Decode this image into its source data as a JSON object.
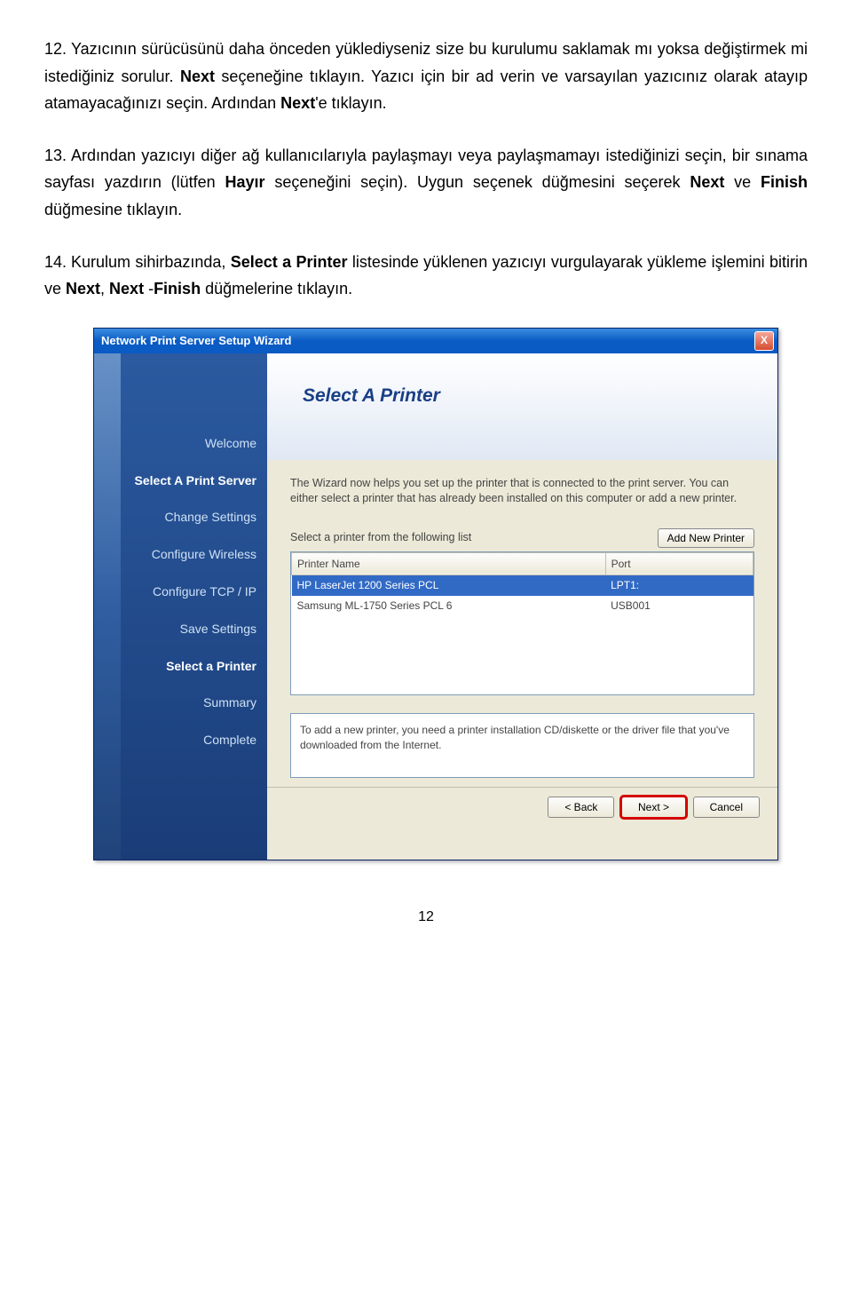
{
  "paragraphs": {
    "p12": {
      "num": "12.",
      "text_a": "Yazıcının sürücüsünü daha önceden yüklediyseniz size bu kurulumu saklamak mı yoksa değiştirmek mi istediğiniz sorulur. ",
      "bold_a": "Next",
      "text_b": " seçeneğine tıklayın. Yazıcı için bir ad verin ve varsayılan yazıcınız olarak atayıp atamayacağınızı seçin. Ardından ",
      "bold_b": "Next",
      "text_c": "'e tıklayın."
    },
    "p13": {
      "num": "13.",
      "text_a": "Ardından yazıcıyı diğer ağ kullanıcılarıyla paylaşmayı veya paylaşmamayı istediğinizi seçin, bir sınama sayfası yazdırın (lütfen ",
      "bold_a": "Hayır",
      "text_b": " seçeneğini seçin). Uygun seçenek düğmesini seçerek ",
      "bold_b": "Next",
      "text_c": " ve ",
      "bold_c": "Finish",
      "text_d": " düğmesine tıklayın."
    },
    "p14": {
      "num": "14.",
      "text_a": "Kurulum sihirbazında, ",
      "bold_a": "Select a Printer",
      "text_b": " listesinde yüklenen yazıcıyı vurgulayarak yükleme işlemini bitirin ve ",
      "bold_b": "Next",
      "text_c": ", ",
      "bold_c": "Next",
      "text_d": " -",
      "bold_d": "Finish",
      "text_e": " düğmelerine tıklayın."
    }
  },
  "wizard": {
    "title": "Network Print Server Setup Wizard",
    "close": "X",
    "sidebar": [
      "Welcome",
      "Select A Print Server",
      "Change Settings",
      "Configure Wireless",
      "Configure TCP / IP",
      "Save Settings",
      "Select a Printer",
      "Summary",
      "Complete"
    ],
    "sidebar_active_index": 6,
    "main_heading": "Select A Printer",
    "desc": "The Wizard now helps you set up the printer that is connected to the print server. You can either select a printer that has already been installed on this computer or add a new printer.",
    "list_label": "Select a printer from the following list",
    "add_btn": "Add New Printer",
    "columns": {
      "name": "Printer Name",
      "port": "Port"
    },
    "rows": [
      {
        "name": "HP LaserJet 1200 Series PCL",
        "port": "LPT1:"
      },
      {
        "name": "Samsung ML-1750 Series PCL 6",
        "port": "USB001"
      }
    ],
    "selected_row_index": 0,
    "note": "To add a new printer, you need a printer installation CD/diskette or the driver file that you've downloaded from the Internet.",
    "buttons": {
      "back": "< Back",
      "next": "Next >",
      "cancel": "Cancel"
    }
  },
  "page_number": "12"
}
